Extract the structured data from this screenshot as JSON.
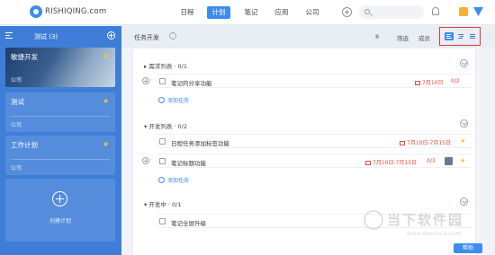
{
  "app": {
    "logo_text": "RISHIQING.com"
  },
  "nav": {
    "items": [
      "日程",
      "计划",
      "笔记",
      "应用",
      "公司"
    ],
    "active": "计划"
  },
  "sidebar": {
    "title": "测试 (3)",
    "cards": [
      {
        "title": "敏捷开发",
        "subtitle": "公司"
      },
      {
        "title": "测试",
        "subtitle": "公司"
      },
      {
        "title": "工作计划",
        "subtitle": "公司"
      }
    ],
    "create_label": "创建计划"
  },
  "main": {
    "project_title": "任务开发",
    "toolbar": {
      "members": "8",
      "filter": "筛选",
      "group": "成员"
    }
  },
  "sections": [
    {
      "name": "需求列表",
      "count": "0/1",
      "tasks": [
        {
          "text": "笔记的分享功能",
          "date": "7月10日",
          "sub": "0/2"
        }
      ],
      "add_label": "添加任务"
    },
    {
      "name": "开发列表",
      "count": "0/2",
      "tasks": [
        {
          "text": "日程任务添加标签功能",
          "date": "7月10日-7月15日"
        },
        {
          "text": "笔记标题功能",
          "date": "7月10日-7月15日",
          "sub": "0/3"
        }
      ],
      "add_label": "添加任务"
    },
    {
      "name": "开发中",
      "count": "0/1",
      "tasks": [
        {
          "text": "笔记全屏升级"
        }
      ]
    }
  ],
  "watermark": {
    "brand": "当下软件园",
    "url": "www.downxia.com"
  },
  "footer": {
    "button": "帮助"
  }
}
